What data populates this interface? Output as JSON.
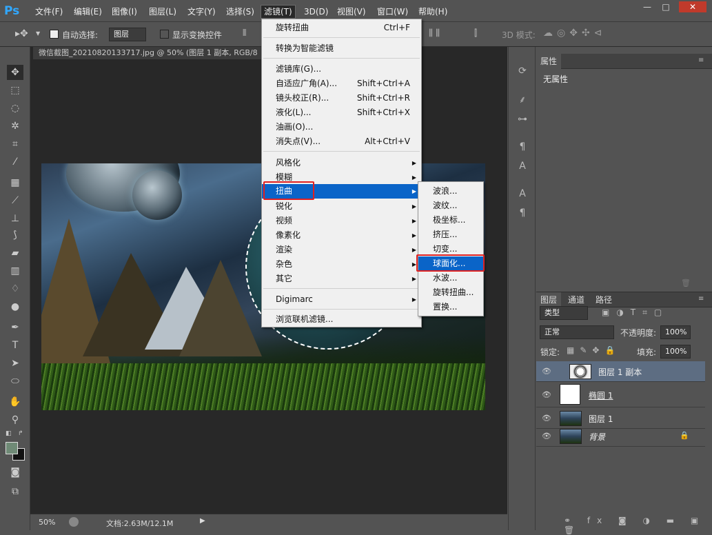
{
  "app": {
    "logo": "Ps"
  },
  "menubar": {
    "items": [
      "文件(F)",
      "编辑(E)",
      "图像(I)",
      "图层(L)",
      "文字(Y)",
      "选择(S)",
      "滤镜(T)",
      "3D(D)",
      "视图(V)",
      "窗口(W)",
      "帮助(H)"
    ],
    "window_controls": [
      "—",
      "□",
      "✕"
    ]
  },
  "options": {
    "auto_select_label": "自动选择:",
    "auto_select_value": "图层",
    "show_transform_label": "显示变换控件",
    "mode_3d_label": "3D 模式:"
  },
  "document": {
    "tab_title": "微信截图_20210820133717.jpg @ 50% (图层 1 副本, RGB/8"
  },
  "status": {
    "zoom": "50%",
    "doc_info": "文档:2.63M/12.1M"
  },
  "filter_menu": {
    "items": [
      {
        "label": "旋转扭曲",
        "shortcut": "Ctrl+F"
      },
      {
        "label": "转换为智能滤镜",
        "shortcut": ""
      },
      {
        "label": "滤镜库(G)...",
        "shortcut": ""
      },
      {
        "label": "自适应广角(A)...",
        "shortcut": "Shift+Ctrl+A"
      },
      {
        "label": "镜头校正(R)...",
        "shortcut": "Shift+Ctrl+R"
      },
      {
        "label": "液化(L)...",
        "shortcut": "Shift+Ctrl+X"
      },
      {
        "label": "油画(O)...",
        "shortcut": ""
      },
      {
        "label": "消失点(V)...",
        "shortcut": "Alt+Ctrl+V"
      },
      {
        "label": "风格化",
        "shortcut": ""
      },
      {
        "label": "模糊",
        "shortcut": ""
      },
      {
        "label": "扭曲",
        "shortcut": ""
      },
      {
        "label": "锐化",
        "shortcut": ""
      },
      {
        "label": "视频",
        "shortcut": ""
      },
      {
        "label": "像素化",
        "shortcut": ""
      },
      {
        "label": "渲染",
        "shortcut": ""
      },
      {
        "label": "杂色",
        "shortcut": ""
      },
      {
        "label": "其它",
        "shortcut": ""
      },
      {
        "label": "Digimarc",
        "shortcut": ""
      },
      {
        "label": "浏览联机滤镜...",
        "shortcut": ""
      }
    ],
    "highlighted": "扭曲"
  },
  "distort_submenu": {
    "items": [
      "波浪...",
      "波纹...",
      "极坐标...",
      "挤压...",
      "切变...",
      "球面化...",
      "水波...",
      "旋转扭曲...",
      "置换..."
    ],
    "highlighted": "球面化..."
  },
  "properties": {
    "tab": "属性",
    "empty_text": "无属性"
  },
  "layers_panel": {
    "tabs": [
      "图层",
      "通道",
      "路径"
    ],
    "filter_kind": "类型",
    "blend_mode": "正常",
    "opacity_label": "不透明度:",
    "opacity_value": "100%",
    "lock_label": "锁定:",
    "fill_label": "填充:",
    "fill_value": "100%",
    "layers": [
      {
        "name": "图层 1 副本",
        "selected": true
      },
      {
        "name": "椭圆 1",
        "selected": false
      },
      {
        "name": "图层 1",
        "selected": false
      },
      {
        "name": "背景",
        "selected": false
      }
    ]
  },
  "colors": {
    "highlight": "#0a64c8",
    "annotation_red": "#e02020",
    "panel_bg": "#535353",
    "selected_layer": "#5d6d82"
  }
}
